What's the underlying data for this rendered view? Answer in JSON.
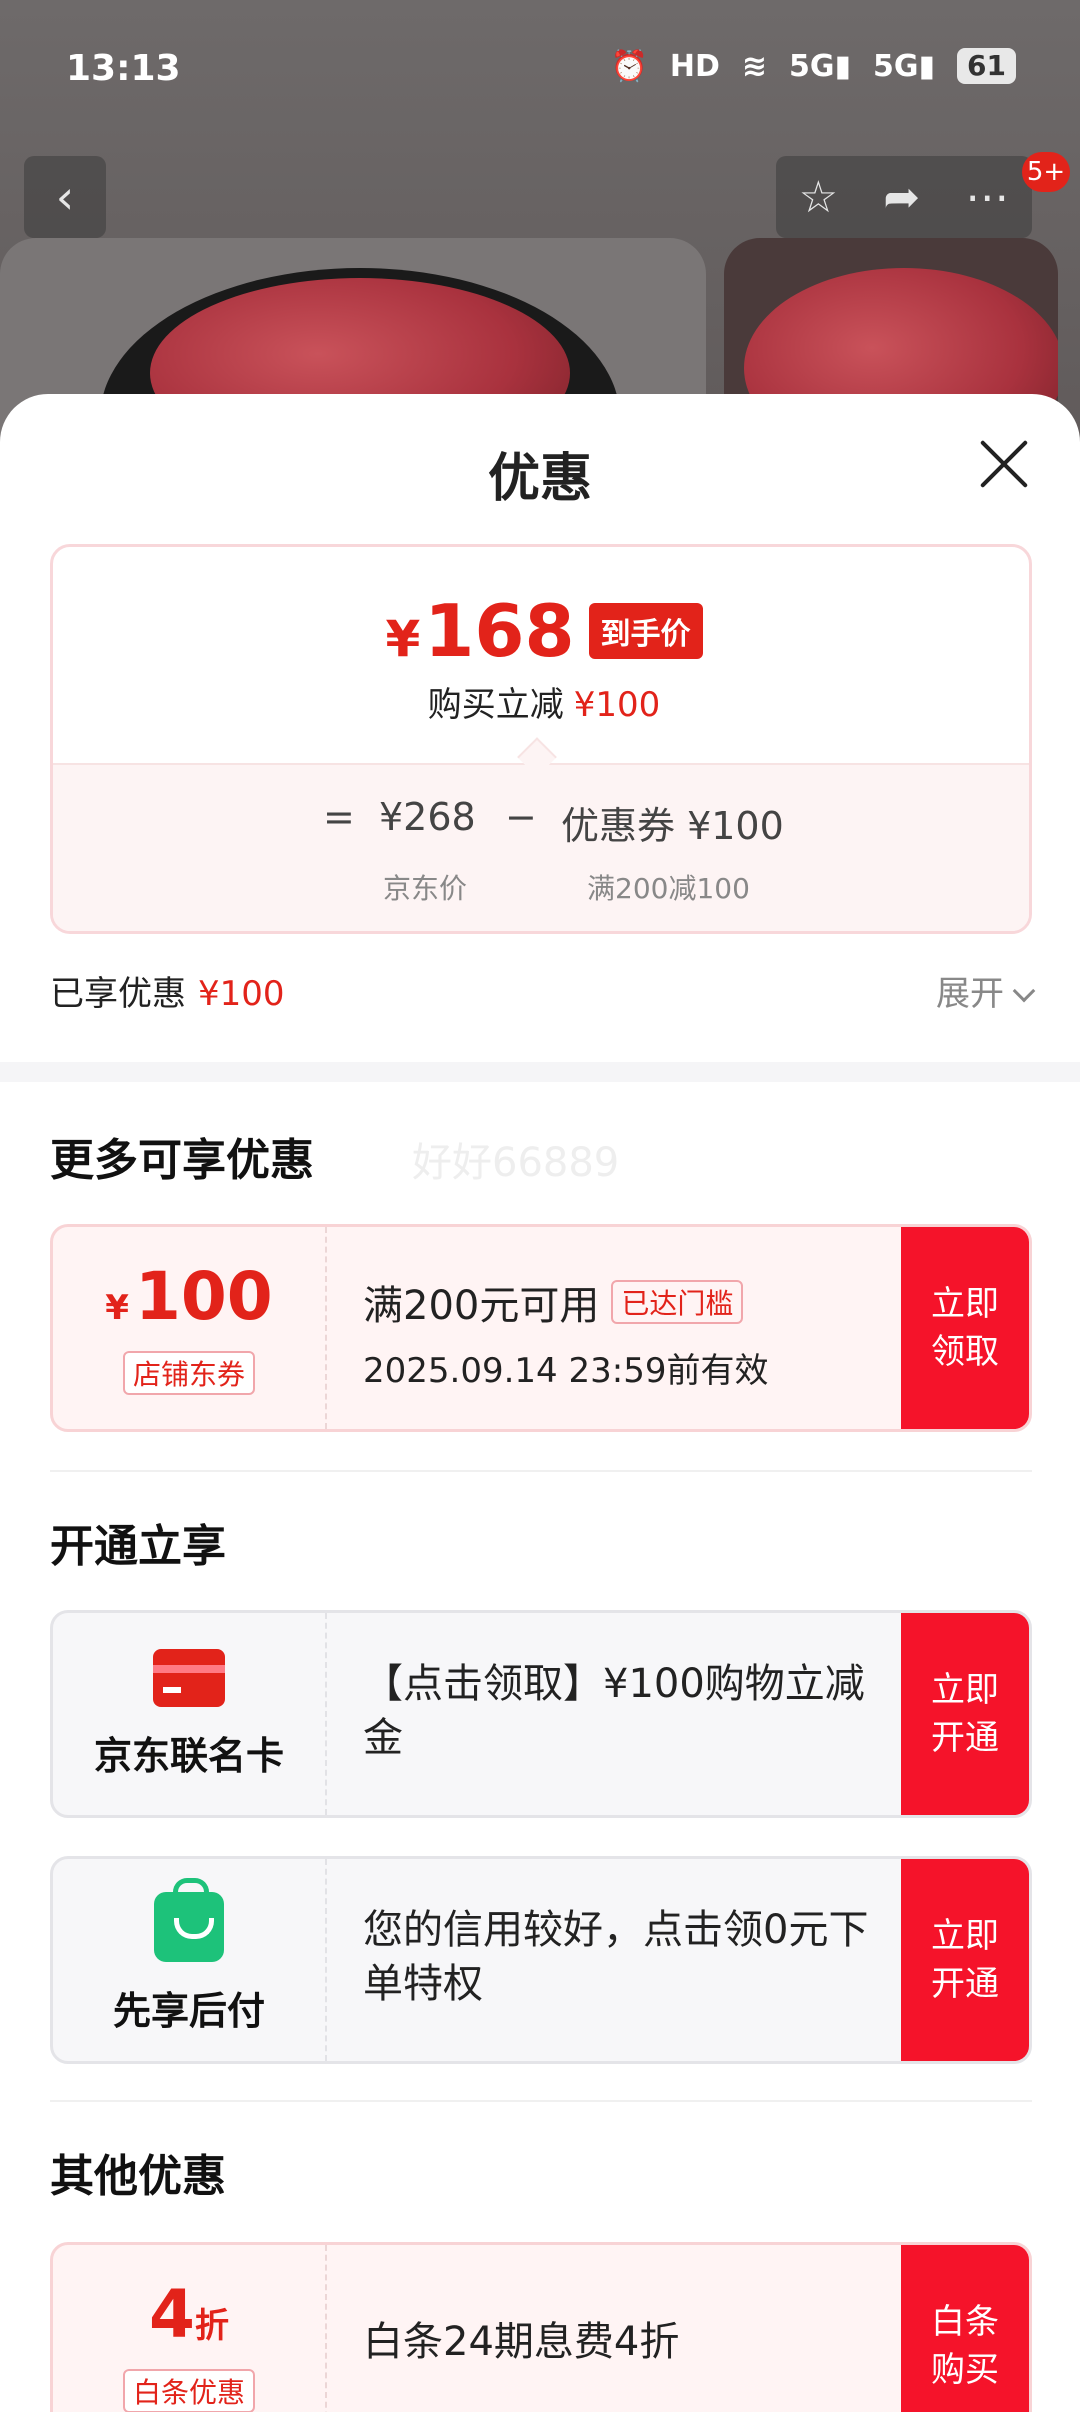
{
  "status_bar": {
    "time": "13:13",
    "icons": [
      "alarm-icon",
      "hd-icon",
      "wifi-icon",
      "signal-5g-icon",
      "signal-5g-icon"
    ],
    "battery": "61"
  },
  "product_page": {
    "notification_badge": "5+"
  },
  "sheet": {
    "title": "优惠",
    "price_summary": {
      "final_price_yen": "¥",
      "final_price": "168",
      "final_tag": "到手价",
      "reduce_label": "购买立减",
      "reduce_amount": "¥100",
      "equals": "=",
      "jd_price": "¥268",
      "minus": "−",
      "coupon_text": "优惠券 ¥100",
      "jd_price_label": "京东价",
      "coupon_rule": "满200减100"
    },
    "enjoyed": {
      "label": "已享优惠",
      "amount": "¥100",
      "expand_label": "展开"
    },
    "more_section": {
      "title": "更多可享优惠",
      "watermark": "好好66889",
      "coupon": {
        "yen": "¥",
        "amount": "100",
        "type": "店铺东券",
        "condition": "满200元可用",
        "reached_tag": "已达门槛",
        "expire": "2025.09.14 23:59前有效",
        "action": "立即领取"
      }
    },
    "open_section": {
      "title": "开通立享",
      "items": [
        {
          "name": "京东联名卡",
          "desc": "【点击领取】¥100购物立减金",
          "action": "立即开通",
          "icon": "credit-card-icon"
        },
        {
          "name": "先享后付",
          "desc": "您的信用较好，点击领0元下单特权",
          "action": "立即开通",
          "icon": "shopping-bag-icon"
        }
      ]
    },
    "other_section": {
      "title": "其他优惠",
      "item": {
        "amount": "4",
        "unit": "折",
        "type": "白条优惠",
        "desc": "白条24期息费4折",
        "action": "白条购买"
      }
    }
  },
  "colors": {
    "accent_red": "#e2231a",
    "button_red": "#f5132a",
    "green": "#1dc27a"
  }
}
